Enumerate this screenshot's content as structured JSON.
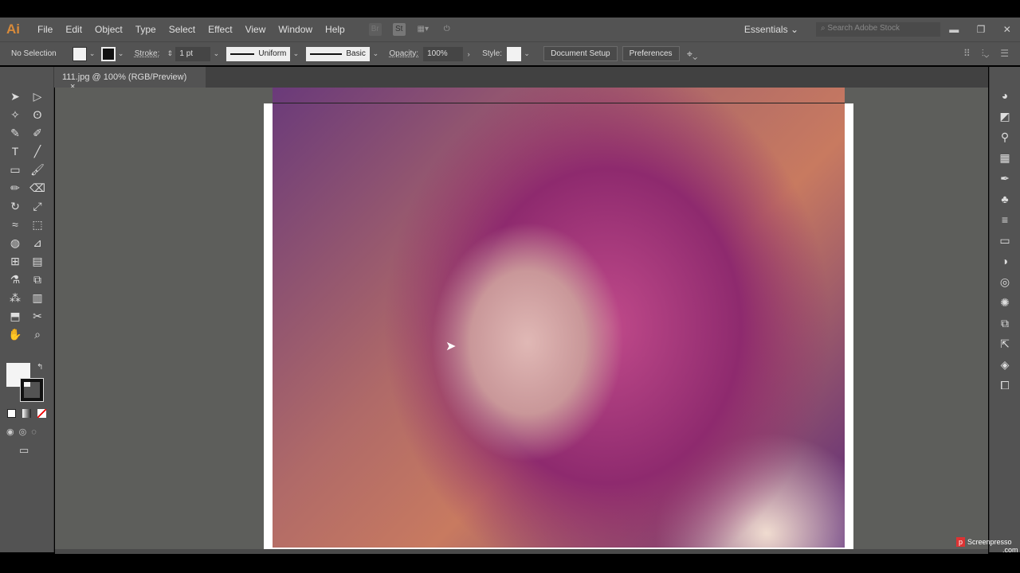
{
  "app": {
    "logo": "Ai"
  },
  "menu": [
    "File",
    "Edit",
    "Object",
    "Type",
    "Select",
    "Effect",
    "View",
    "Window",
    "Help"
  ],
  "menu_icons": [
    "Br",
    "St"
  ],
  "workspace": "Essentials",
  "search_placeholder": "Search Adobe Stock",
  "control": {
    "selection": "No Selection",
    "stroke_label": "Stroke:",
    "stroke_value": "1 pt",
    "profile": "Uniform",
    "brush": "Basic",
    "opacity_label": "Opacity:",
    "opacity_value": "100%",
    "style_label": "Style:",
    "doc_setup": "Document Setup",
    "preferences": "Preferences"
  },
  "tab": {
    "title": "111.jpg @ 100% (RGB/Preview)",
    "close": "×"
  },
  "tools": [
    "selection",
    "direct-selection",
    "magic-wand",
    "lasso",
    "pen",
    "curvature",
    "type",
    "line",
    "rectangle",
    "paintbrush",
    "shaper",
    "eraser",
    "rotate",
    "scale",
    "warp",
    "free-transform",
    "shape-builder",
    "perspective",
    "mesh",
    "gradient",
    "eyedropper",
    "blend",
    "symbol-sprayer",
    "graph",
    "artboard",
    "slice",
    "hand",
    "zoom"
  ],
  "watermark": {
    "name": "Screenpresso",
    "domain": ".com"
  }
}
